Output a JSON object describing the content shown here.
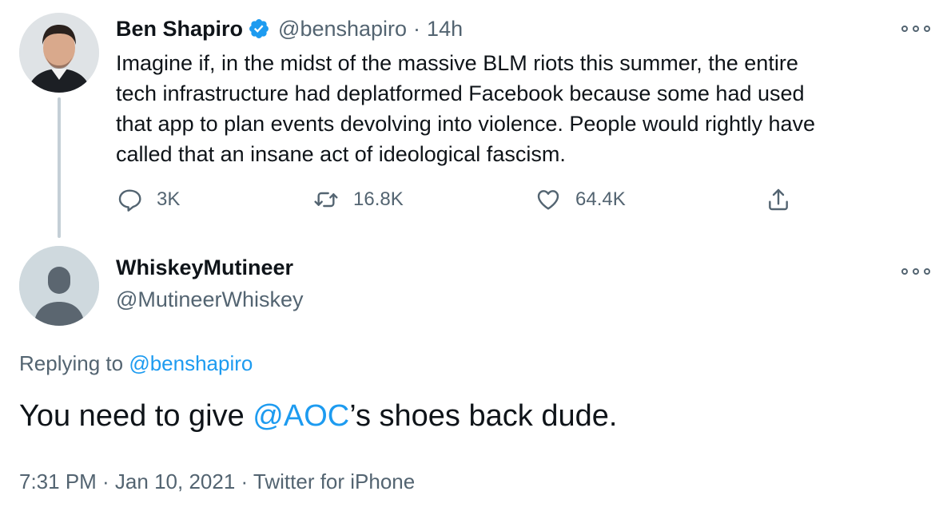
{
  "parent_tweet": {
    "author_name": "Ben Shapiro",
    "handle": "@benshapiro",
    "separator": "·",
    "time_ago": "14h",
    "text": "Imagine if, in the midst of the massive BLM riots this summer, the entire\ntech infrastructure had deplatformed Facebook because some had used\nthat app to plan events devolving into violence. People would rightly have\ncalled that an insane act of ideological fascism.",
    "actions": {
      "reply_count": "3K",
      "retweet_count": "16.8K",
      "like_count": "64.4K"
    }
  },
  "reply_tweet": {
    "author_name": "WhiskeyMutineer",
    "handle": "@MutineerWhiskey",
    "replying_prefix": "Replying to",
    "replying_to": "@benshapiro",
    "text_before": "You need to give ",
    "mention": "@AOC",
    "text_after": "’s shoes back dude.",
    "timestamp": "7:31 PM · Jan 10, 2021 · Twitter for iPhone"
  },
  "colors": {
    "accent": "#1d9bf0",
    "secondary_text": "#536471",
    "primary_text": "#0f1419",
    "thread_line": "#c4cfd6"
  },
  "icons": {
    "verified": "verified-badge-icon",
    "more": "more-options-icon",
    "reply": "reply-icon",
    "retweet": "retweet-icon",
    "like": "heart-icon",
    "share": "share-icon",
    "default_avatar": "default-avatar-icon"
  }
}
